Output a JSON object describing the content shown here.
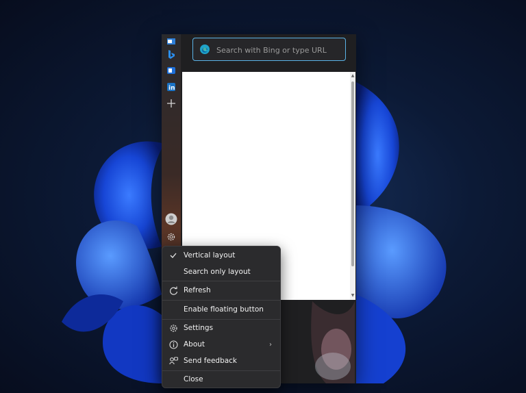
{
  "search": {
    "placeholder": "Search with Bing or type URL"
  },
  "rail": {
    "icons": [
      "outlook-icon",
      "bing-icon",
      "office-icon",
      "linkedin-icon",
      "add-icon",
      "profile-icon",
      "gear-icon"
    ]
  },
  "menu": {
    "items": [
      {
        "label": "Vertical layout",
        "icon": "check-icon",
        "checked": true
      },
      {
        "label": "Search only layout",
        "icon": ""
      },
      {
        "label": "Refresh",
        "icon": "refresh-icon"
      },
      {
        "label": "Enable floating button",
        "icon": ""
      },
      {
        "label": "Settings",
        "icon": "gear-icon"
      },
      {
        "label": "About",
        "icon": "info-icon",
        "submenu": true
      },
      {
        "label": "Send feedback",
        "icon": "feedback-icon"
      },
      {
        "label": "Close",
        "icon": ""
      }
    ]
  },
  "colors": {
    "accent": "#5bb4e8",
    "menu_bg": "#2b2b2d",
    "rail_bg": "#2a2a2d"
  }
}
